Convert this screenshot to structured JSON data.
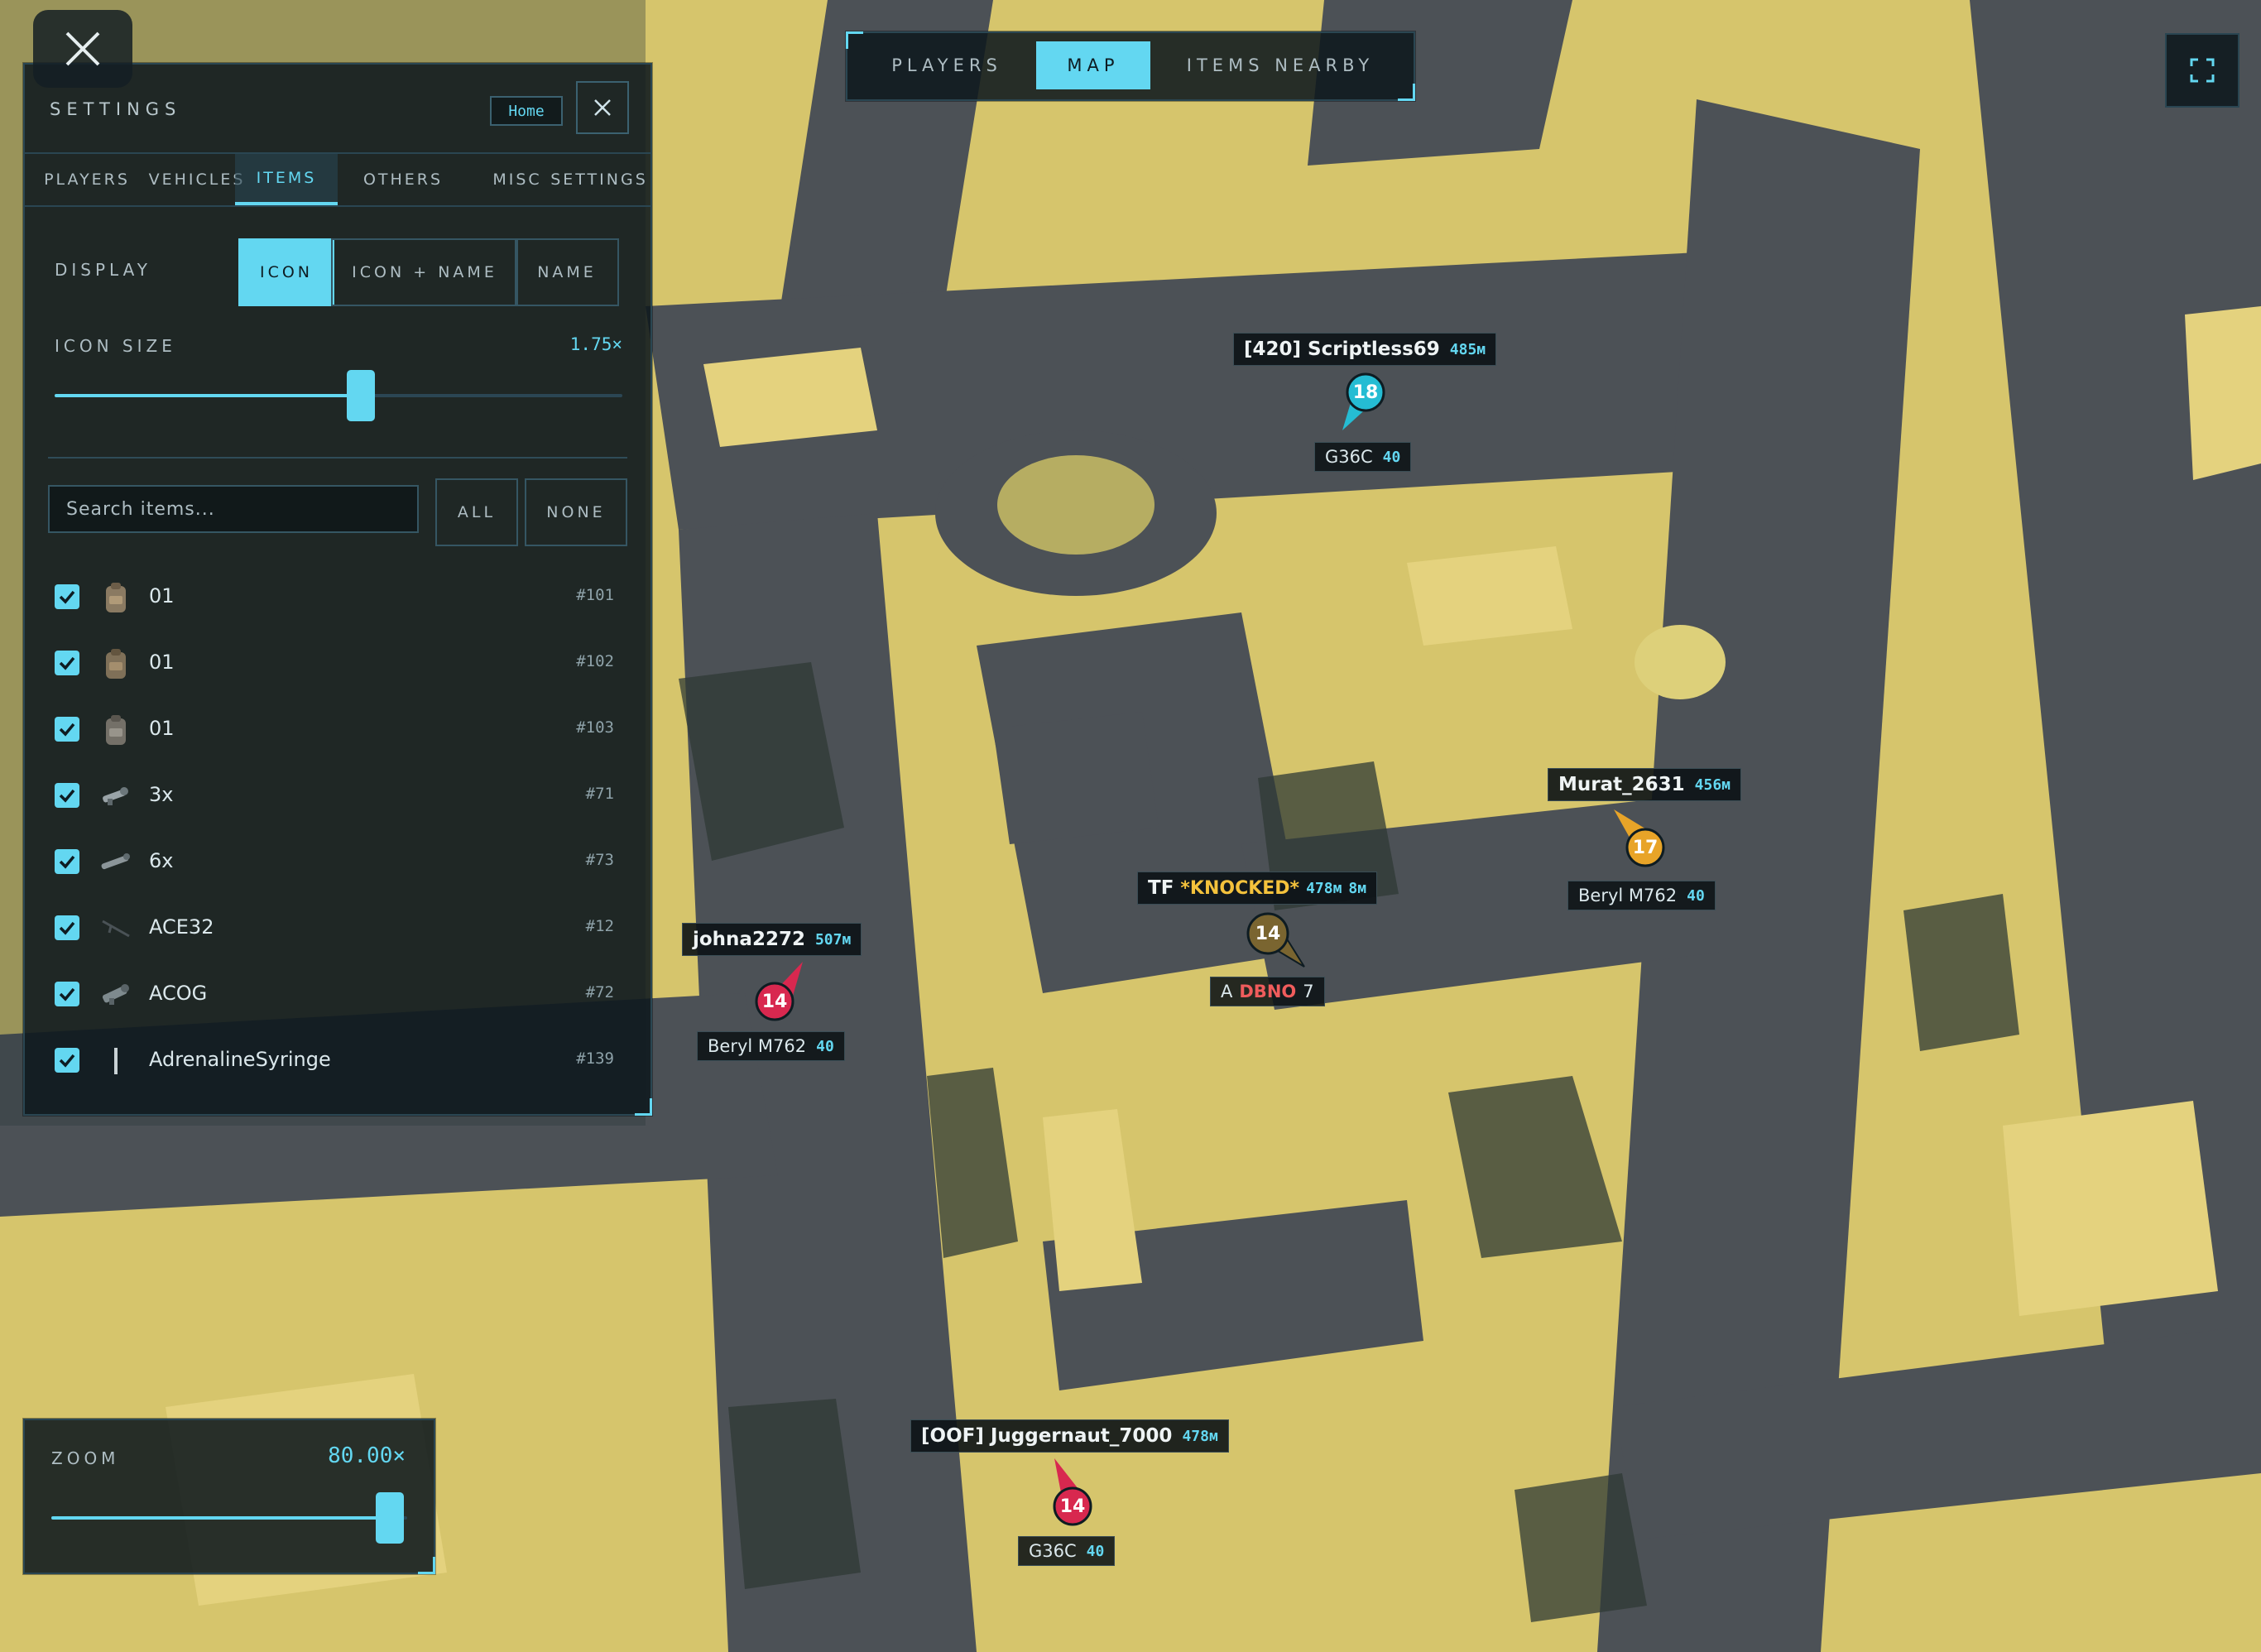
{
  "colors": {
    "accent": "#63d7f1",
    "enemy_red": "#d8284f",
    "ally_cyan": "#25bcd3",
    "knocked": "#7a6530",
    "squad_orange": "#e8a428",
    "dbno_red": "#f05c5c"
  },
  "overlay": {
    "close_icon": "close-x-icon"
  },
  "top_tabs": [
    {
      "label": "PLAYERS",
      "active": false
    },
    {
      "label": "MAP",
      "active": true
    },
    {
      "label": "ITEMS NEARBY",
      "active": false
    }
  ],
  "fullscreen": {
    "icon": "fullscreen-icon"
  },
  "settings": {
    "title": "SETTINGS",
    "home_label": "Home",
    "tabs": [
      {
        "label": "PLAYERS",
        "active": false
      },
      {
        "label": "VEHICLES",
        "active": false
      },
      {
        "label": "ITEMS",
        "active": true
      },
      {
        "label": "OTHERS",
        "active": false
      },
      {
        "label": "MISC",
        "active": false
      },
      {
        "label": "SETTINGS",
        "active": false
      }
    ],
    "display": {
      "label": "DISPLAY",
      "options": [
        {
          "label": "ICON",
          "active": true
        },
        {
          "label": "ICON + NAME",
          "active": false
        },
        {
          "label": "NAME",
          "active": false
        }
      ]
    },
    "icon_size": {
      "label": "ICON SIZE",
      "value": "1.75×",
      "fraction": 0.54
    },
    "search": {
      "placeholder": "Search items...",
      "value": ""
    },
    "all_label": "ALL",
    "none_label": "NONE",
    "items": [
      {
        "name": "01",
        "id": "#101",
        "checked": true,
        "icon": "backpack-icon"
      },
      {
        "name": "01",
        "id": "#102",
        "checked": true,
        "icon": "backpack-icon"
      },
      {
        "name": "01",
        "id": "#103",
        "checked": true,
        "icon": "backpack-icon"
      },
      {
        "name": "3x",
        "id": "#71",
        "checked": true,
        "icon": "scope-icon"
      },
      {
        "name": "6x",
        "id": "#73",
        "checked": true,
        "icon": "scope-icon"
      },
      {
        "name": "ACE32",
        "id": "#12",
        "checked": true,
        "icon": "rifle-icon"
      },
      {
        "name": "ACOG",
        "id": "#72",
        "checked": true,
        "icon": "scope-icon"
      },
      {
        "name": "AdrenalineSyringe",
        "id": "#139",
        "checked": true,
        "icon": "syringe-icon"
      }
    ]
  },
  "zoom": {
    "label": "ZOOM",
    "value": "80.00×",
    "fraction": 0.95
  },
  "players": [
    {
      "name": "[420] Scriptless69",
      "distance": "485м",
      "team": "18",
      "weapon": "G36C",
      "ammo": "40",
      "color": "#25bcd3"
    },
    {
      "name": "Murat_2631",
      "distance": "456м",
      "team": "17",
      "weapon": "Beryl M762",
      "ammo": "40",
      "color": "#e8a428"
    },
    {
      "name": "*KNOCKED*",
      "prefix": "TF",
      "distance": "478м",
      "suffix": "8м",
      "team": "14",
      "status": "DBNO",
      "status_prefix": "A",
      "status_suffix": "7",
      "color": "#7a6530"
    },
    {
      "name": "johna2272",
      "distance": "507м",
      "team": "14",
      "weapon": "Beryl M762",
      "ammo": "40",
      "color": "#d8284f"
    },
    {
      "name": "[OOF] Juggernaut_7000",
      "distance": "478м",
      "team": "14",
      "weapon": "G36C",
      "ammo": "40",
      "color": "#d8284f"
    }
  ]
}
